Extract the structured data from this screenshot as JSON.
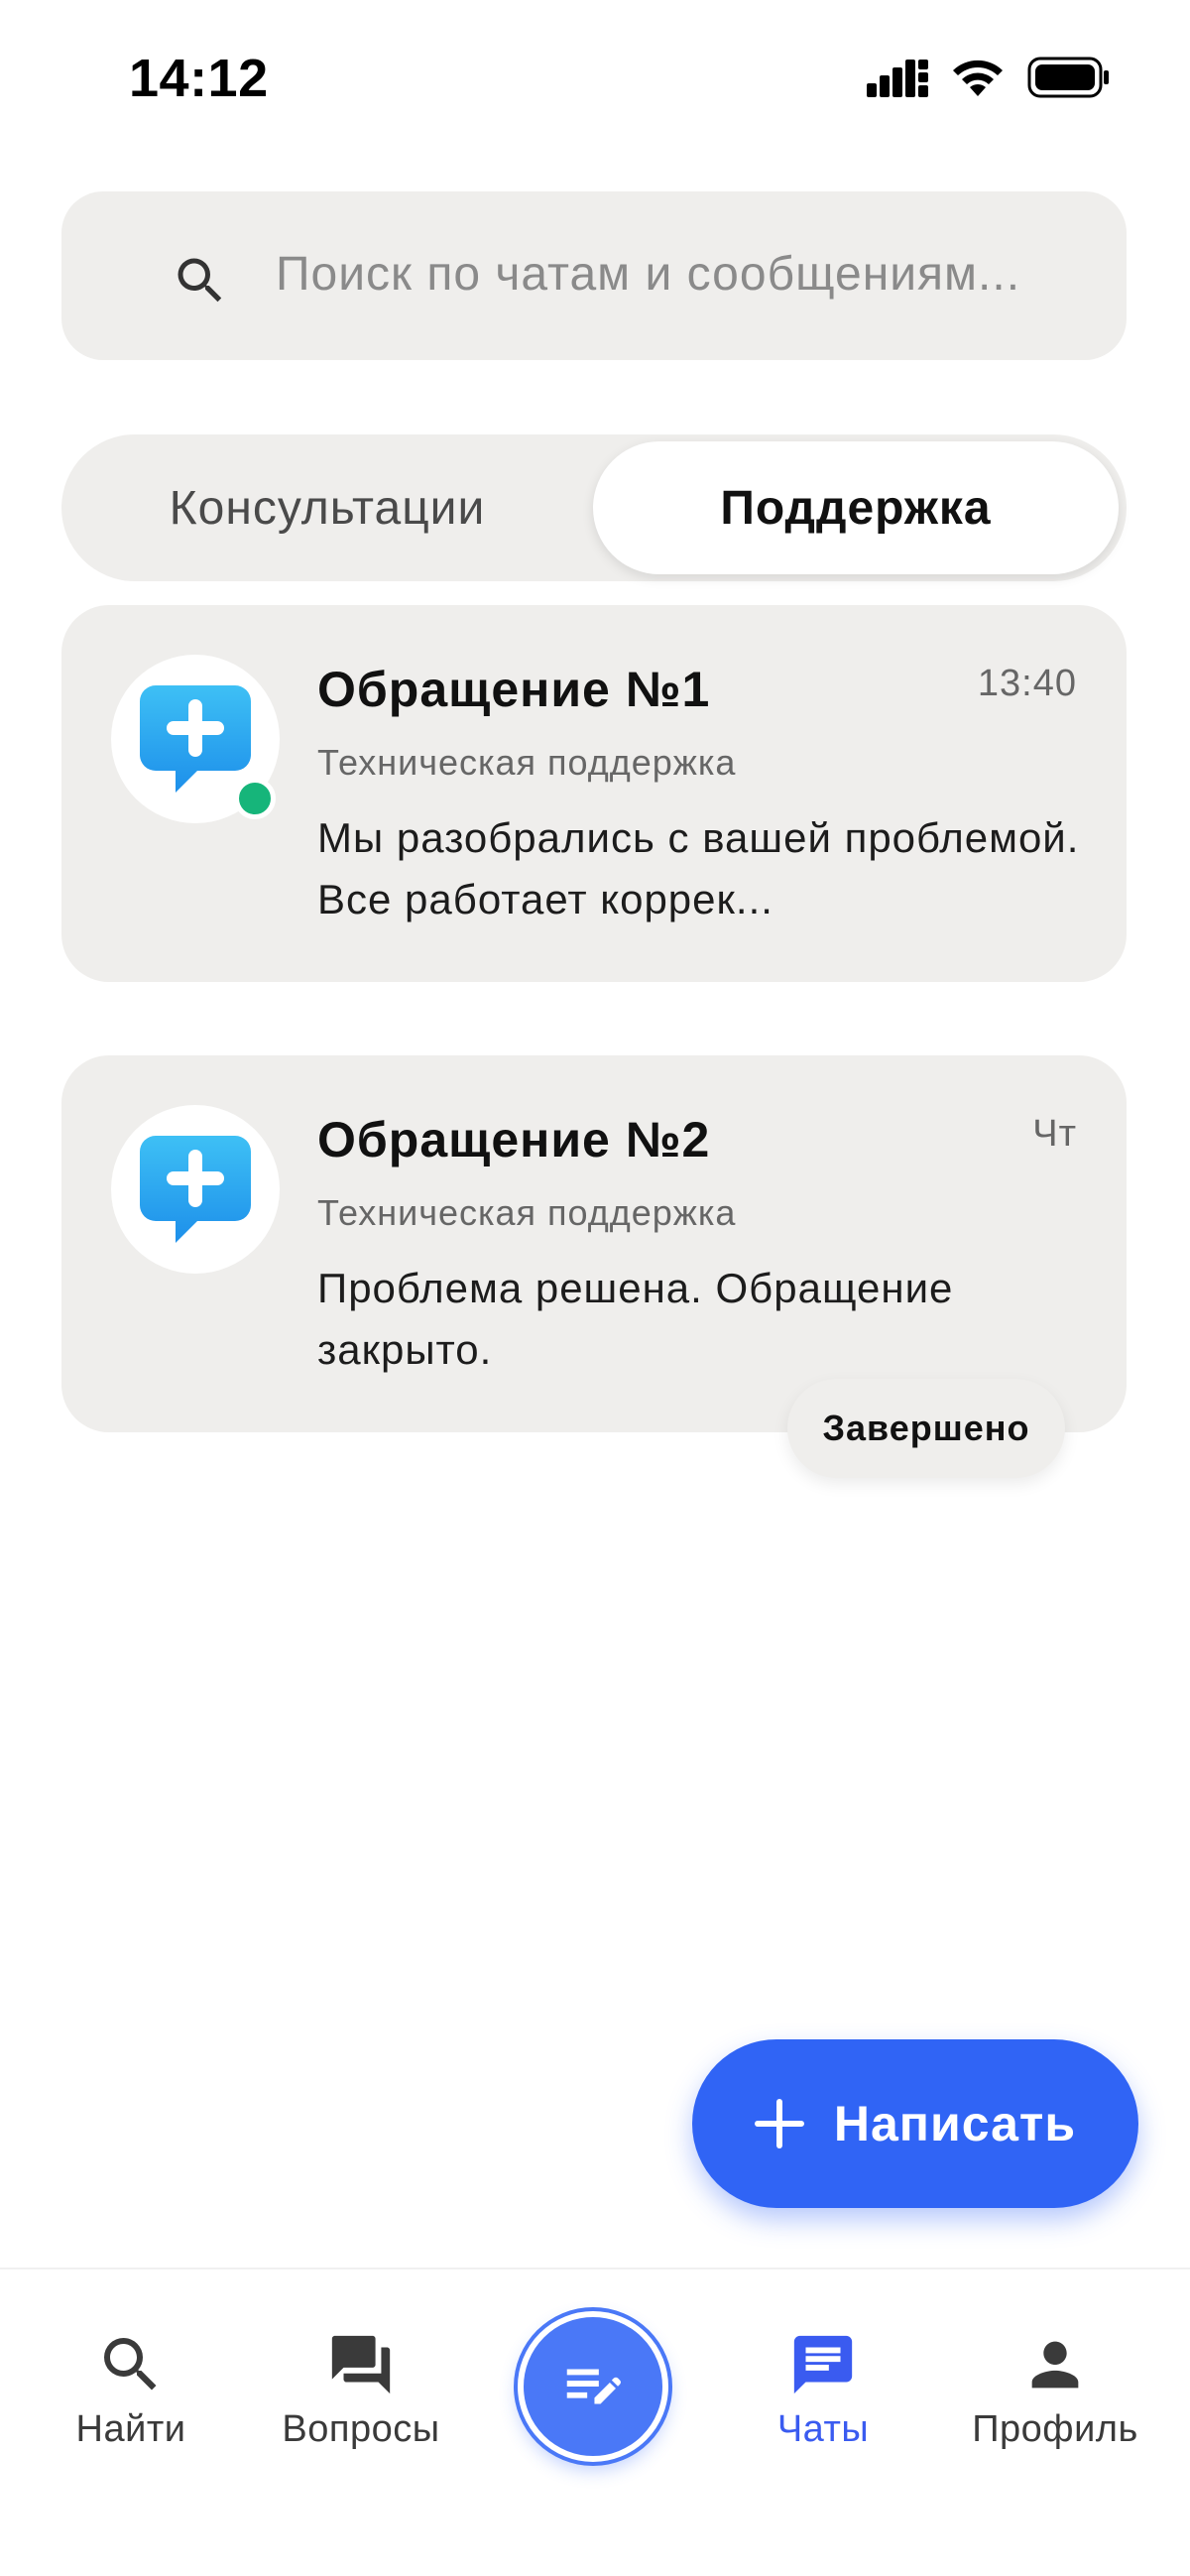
{
  "status_bar": {
    "time": "14:12"
  },
  "search": {
    "placeholder": "Поиск по чатам и сообщениям..."
  },
  "tabs": [
    {
      "label": "Консультации",
      "active": false
    },
    {
      "label": "Поддержка",
      "active": true
    }
  ],
  "tickets": [
    {
      "title": "Обращение №1",
      "time": "13:40",
      "subtitle": "Техническая поддержка",
      "message": "Мы разобрались с вашей проблемой. Все работает коррек...",
      "online": true
    },
    {
      "title": "Обращение №2",
      "time": "Чт",
      "subtitle": "Техническая поддержка",
      "message": "Проблема решена. Обращение закрыто.",
      "status": "Завершено"
    }
  ],
  "fab": {
    "label": "Написать"
  },
  "nav": {
    "items": [
      {
        "label": "Найти",
        "icon": "search-icon"
      },
      {
        "label": "Вопросы",
        "icon": "forum-icon"
      },
      {
        "label": "",
        "icon": "edit-note-icon"
      },
      {
        "label": "Чаты",
        "icon": "chat-icon",
        "active": true
      },
      {
        "label": "Профиль",
        "icon": "person-icon"
      }
    ]
  },
  "colors": {
    "accent": "#3064f5",
    "online": "#16b57a",
    "card_bg": "#efeeec",
    "nav_active": "#3a5bf0"
  }
}
